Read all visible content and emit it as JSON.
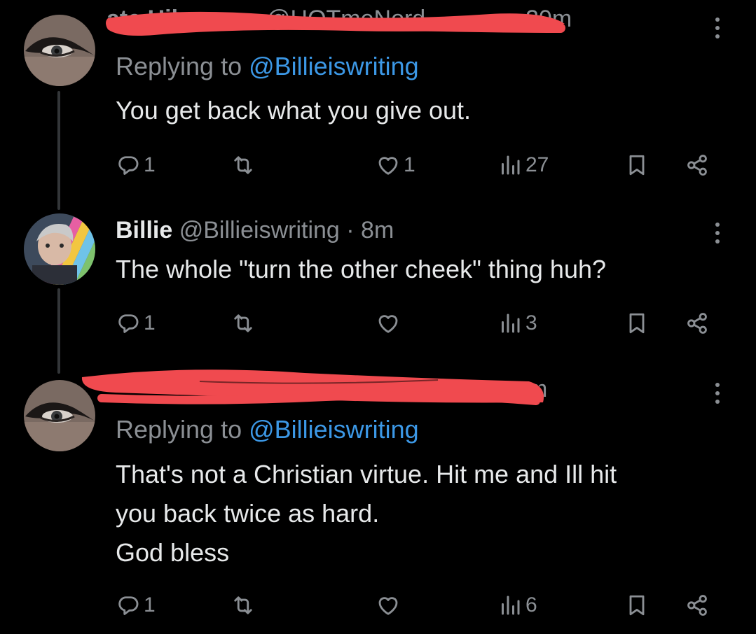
{
  "colors": {
    "background": "#000000",
    "text": "#e7e9ea",
    "muted": "#8b8f94",
    "mention": "#3c98e6",
    "redaction": "#f04a4f"
  },
  "posts": [
    {
      "redacted": true,
      "time": "20m",
      "replying_prefix": "Replying to ",
      "replying_to": "@Billieiswriting",
      "text": "You get back what you give out.",
      "stats": {
        "replies": "1",
        "reposts": "",
        "likes": "1",
        "views": "27"
      }
    },
    {
      "name": "Billie",
      "handle": "@Billieiswriting",
      "separator": " · ",
      "time": "8m",
      "text": "The whole \"turn the other cheek\" thing huh?",
      "stats": {
        "replies": "1",
        "reposts": "",
        "likes": "",
        "views": "3"
      }
    },
    {
      "redacted": true,
      "time": "m",
      "replying_prefix": "Replying to ",
      "replying_to": "@Billieiswriting",
      "text_lines": [
        "That's not a Christian virtue. Hit me and Ill hit",
        "you back twice as hard.",
        "God bless"
      ],
      "stats": {
        "replies": "1",
        "reposts": "",
        "likes": "",
        "views": "6"
      }
    }
  ],
  "icons": [
    "reply-icon",
    "repost-icon",
    "like-icon",
    "views-icon",
    "bookmark-icon",
    "share-icon",
    "more-options-icon"
  ]
}
